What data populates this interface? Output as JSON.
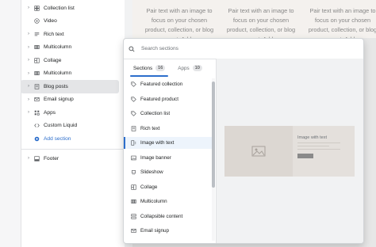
{
  "sidebar": {
    "items": [
      {
        "label": "Collection list",
        "icon": "collection-list-icon",
        "expandable": true
      },
      {
        "label": "Video",
        "icon": "video-icon",
        "expandable": false
      },
      {
        "label": "Rich text",
        "icon": "rich-text-icon",
        "expandable": true
      },
      {
        "label": "Multicolumn",
        "icon": "multicolumn-icon",
        "expandable": true
      },
      {
        "label": "Collage",
        "icon": "collage-icon",
        "expandable": true
      },
      {
        "label": "Multicolumn",
        "icon": "multicolumn-icon",
        "expandable": true
      },
      {
        "label": "Blog posts",
        "icon": "blog-posts-icon",
        "expandable": true
      },
      {
        "label": "Email signup",
        "icon": "email-signup-icon",
        "expandable": true
      },
      {
        "label": "Apps",
        "icon": "apps-icon",
        "expandable": true
      },
      {
        "label": "Custom Liquid",
        "icon": "code-icon",
        "expandable": false
      },
      {
        "label": "Add section",
        "icon": "add-section-icon",
        "expandable": false
      },
      {
        "label": "Footer",
        "icon": "footer-icon",
        "expandable": true
      }
    ]
  },
  "preview": {
    "columns": [
      "Pair text with an image to focus on your chosen product, collection, or blog post. Add",
      "Pair text with an image to focus on your chosen product, collection, or blog post. Add",
      "Pair text with an image to focus on your chosen product, collection, or blog post. Add"
    ]
  },
  "popover": {
    "search_placeholder": "Search sections",
    "tabs": [
      {
        "label": "Sections",
        "count": "16"
      },
      {
        "label": "Apps",
        "count": "10"
      }
    ],
    "items": [
      {
        "label": "Featured collection",
        "icon": "tag-icon"
      },
      {
        "label": "Featured product",
        "icon": "tag-icon"
      },
      {
        "label": "Collection list",
        "icon": "tag-icon"
      },
      {
        "label": "Rich text",
        "icon": "text-icon"
      },
      {
        "label": "Image with text",
        "icon": "image-with-text-icon"
      },
      {
        "label": "Image banner",
        "icon": "image-icon"
      },
      {
        "label": "Slideshow",
        "icon": "slideshow-icon"
      },
      {
        "label": "Collage",
        "icon": "collage-icon"
      },
      {
        "label": "Multicolumn",
        "icon": "multicolumn-icon"
      },
      {
        "label": "Collapsible content",
        "icon": "collapsible-icon"
      },
      {
        "label": "Email signup",
        "icon": "email-icon"
      }
    ],
    "preview_title": "Image with text"
  },
  "colors": {
    "accent": "#2c6ecb",
    "sidebar_bg": "#ffffff",
    "preview_bg": "#e7e7e7"
  }
}
